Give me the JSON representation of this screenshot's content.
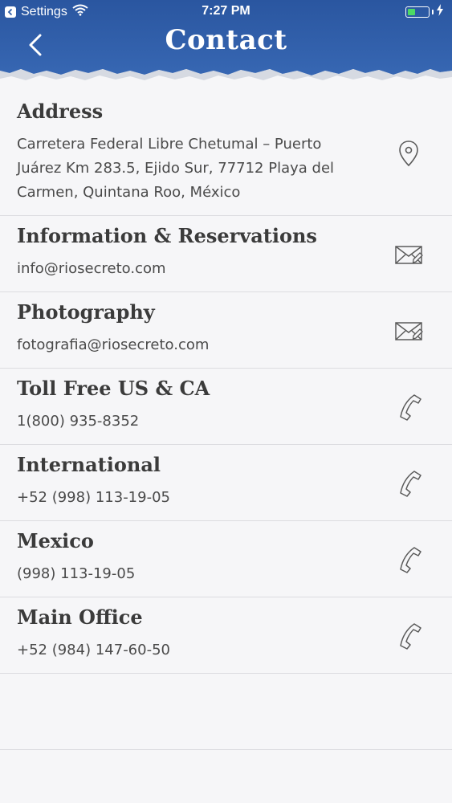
{
  "status_bar": {
    "back_app": "Settings",
    "time": "7:27 PM"
  },
  "header": {
    "title": "Contact",
    "color": "#2f5ea8"
  },
  "contacts": [
    {
      "title": "Address",
      "value": "Carretera Federal Libre Chetumal – Puerto Juárez Km 283.5, Ejido Sur, 77712 Playa del Carmen, Quintana Roo, México",
      "icon": "location-pin-icon"
    },
    {
      "title": "Information & Reservations",
      "value": "info@riosecreto.com",
      "icon": "envelope-icon"
    },
    {
      "title": "Photography",
      "value": "fotografia@riosecreto.com",
      "icon": "envelope-icon"
    },
    {
      "title": "Toll Free US & CA",
      "value": "1(800) 935-8352",
      "icon": "phone-icon"
    },
    {
      "title": "International",
      "value": "+52 (998) 113-19-05",
      "icon": "phone-icon"
    },
    {
      "title": "Mexico",
      "value": "(998) 113-19-05",
      "icon": "phone-icon"
    },
    {
      "title": "Main Office",
      "value": "+52 (984) 147-60-50",
      "icon": "phone-icon"
    }
  ]
}
